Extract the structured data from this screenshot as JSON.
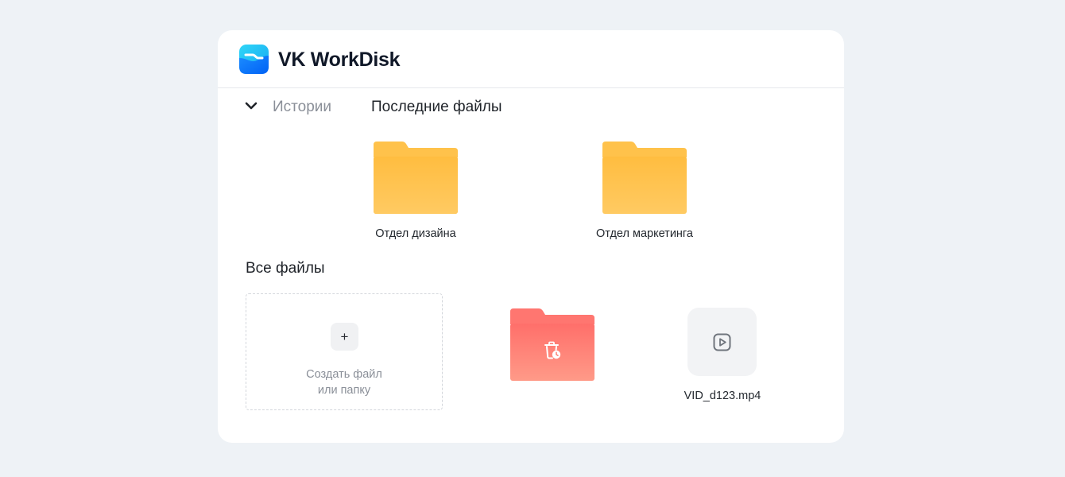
{
  "app": {
    "title": "VK WorkDisk"
  },
  "tabs": {
    "stories": "Истории",
    "recent": "Последние файлы"
  },
  "recent_folders": [
    {
      "name": "Отдел дизайна",
      "color": "#FFC24B"
    },
    {
      "name": "Отдел маркетинга",
      "color": "#FFC24B"
    }
  ],
  "all_files": {
    "title": "Все файлы",
    "create": {
      "icon": "plus-icon",
      "line1": "Создать файл",
      "line2": "или папку"
    },
    "trash_folder": {
      "icon": "trash-clock-icon",
      "color": "#FF7670"
    },
    "video_file": {
      "icon": "video-play-icon",
      "name": "VID_d123.mp4"
    }
  },
  "colors": {
    "background": "#EEF2F6",
    "card": "#FFFFFF",
    "folder_yellow": "#FFC24B",
    "folder_red": "#FF7670",
    "logo_blue": "#0077FF",
    "logo_cyan": "#20C8F5"
  }
}
